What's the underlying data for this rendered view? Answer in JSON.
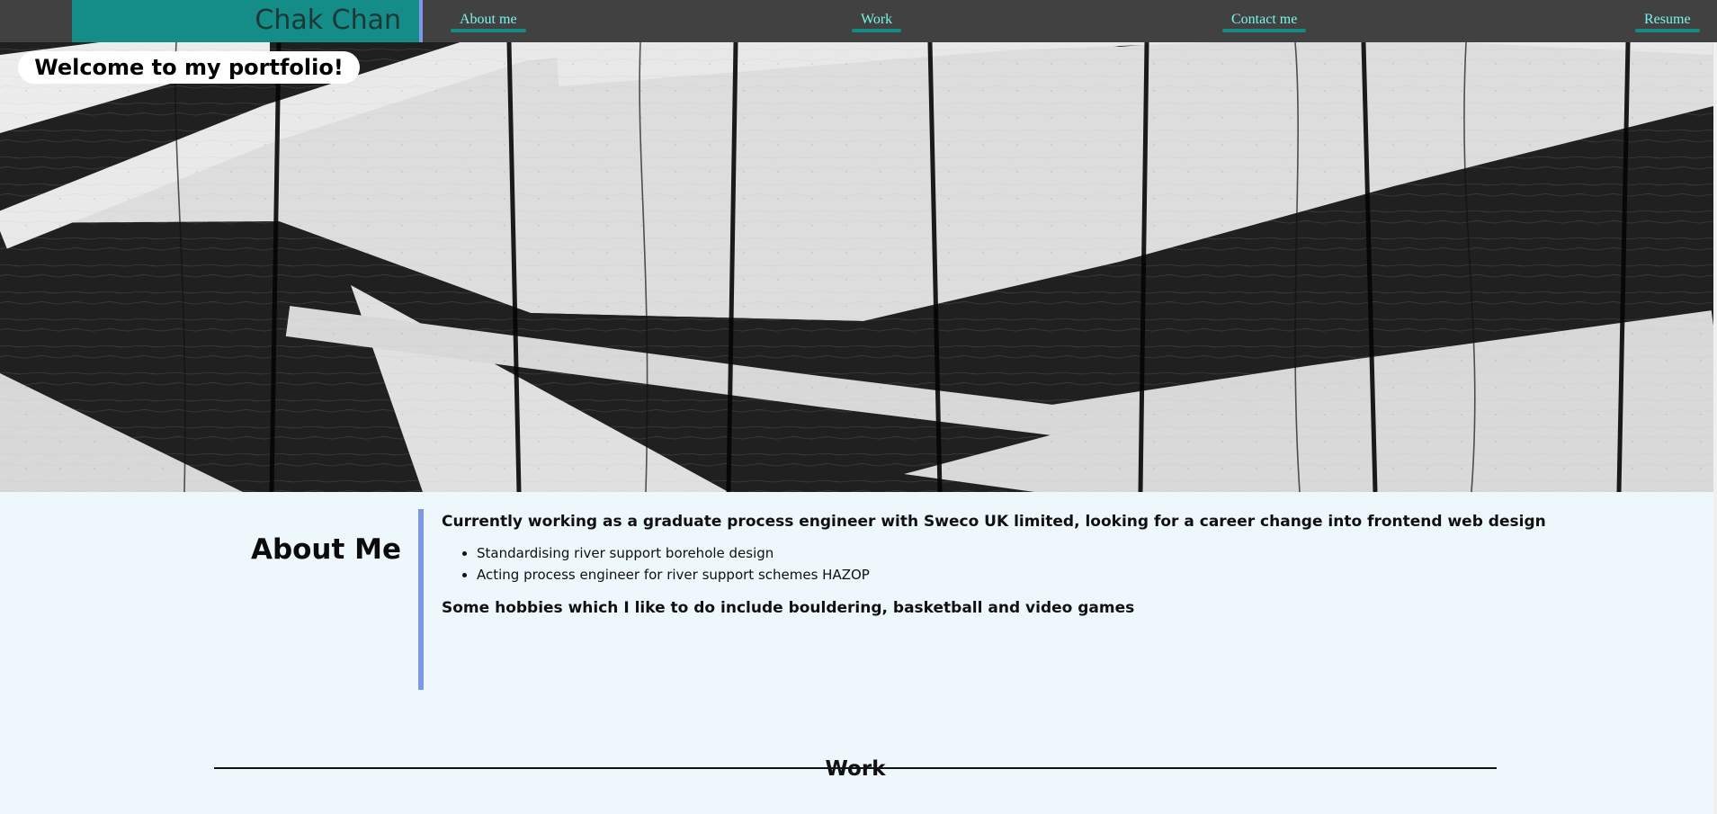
{
  "header": {
    "brand_name": "Chak Chan",
    "nav": [
      {
        "label": "About me"
      },
      {
        "label": "Work"
      },
      {
        "label": "Contact me"
      },
      {
        "label": "Resume"
      }
    ]
  },
  "hero": {
    "welcome_text": "Welcome to my portfolio!"
  },
  "about": {
    "title": "About Me",
    "intro": "Currently working as a graduate process engineer with Sweco UK limited, looking for a career change into frontend web design",
    "items": [
      "Standardising river support borehole design",
      "Acting process engineer for river support schemes HAZOP"
    ],
    "hobbies": "Some hobbies which I like to do include bouldering, basketball and video games"
  },
  "work": {
    "title": "Work"
  },
  "theme": {
    "header_background": "#414141",
    "brand_background": "#148c87",
    "nav_text": "#79f5f0",
    "accent_blue": "#7d98e7",
    "page_background": "#eef7fc"
  }
}
